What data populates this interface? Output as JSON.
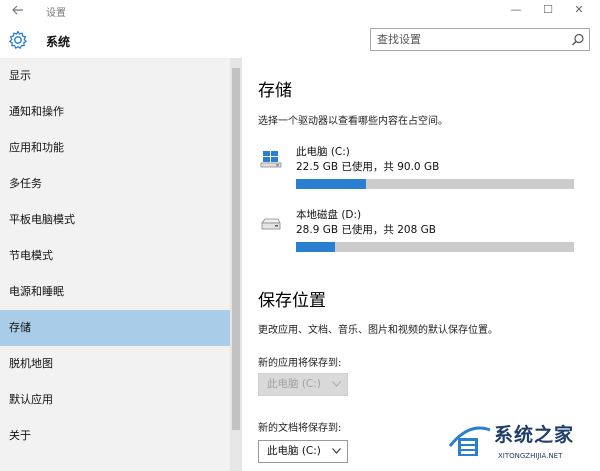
{
  "window": {
    "title": "设置",
    "controls": {
      "minimize": "—",
      "maximize": "☐",
      "close": "✕"
    }
  },
  "header": {
    "section_title": "系统",
    "search_placeholder": "查找设置"
  },
  "sidebar": {
    "items": [
      {
        "label": "显示"
      },
      {
        "label": "通知和操作"
      },
      {
        "label": "应用和功能"
      },
      {
        "label": "多任务"
      },
      {
        "label": "平板电脑模式"
      },
      {
        "label": "节电模式"
      },
      {
        "label": "电源和睡眠"
      },
      {
        "label": "存储",
        "selected": true
      },
      {
        "label": "脱机地图"
      },
      {
        "label": "默认应用"
      },
      {
        "label": "关于"
      }
    ]
  },
  "storage": {
    "heading": "存储",
    "description": "选择一个驱动器以查看哪些内容在占空间。",
    "drives": [
      {
        "name": "此电脑 (C:)",
        "usage": "22.5 GB 已使用，共 90.0 GB",
        "used_fraction": 0.25,
        "icon": "windows-drive-icon"
      },
      {
        "name": "本地磁盘 (D:)",
        "usage": "28.9 GB 已使用，共 208 GB",
        "used_fraction": 0.139,
        "icon": "hard-drive-icon"
      }
    ]
  },
  "save_locations": {
    "heading": "保存位置",
    "description": "更改应用、文档、音乐、图片和视频的默认保存位置。",
    "apps_label": "新的应用将保存到:",
    "apps_value": "此电脑 (C:)",
    "docs_label": "新的文档将保存到:",
    "docs_value": "此电脑 (C:)"
  },
  "watermark": {
    "text": "系统之家",
    "url": "XITONGZHIJIA.NET"
  },
  "colors": {
    "accent": "#2a7fd0",
    "selection": "#a9cde9",
    "sidebar_bg": "#f2f2f2"
  }
}
